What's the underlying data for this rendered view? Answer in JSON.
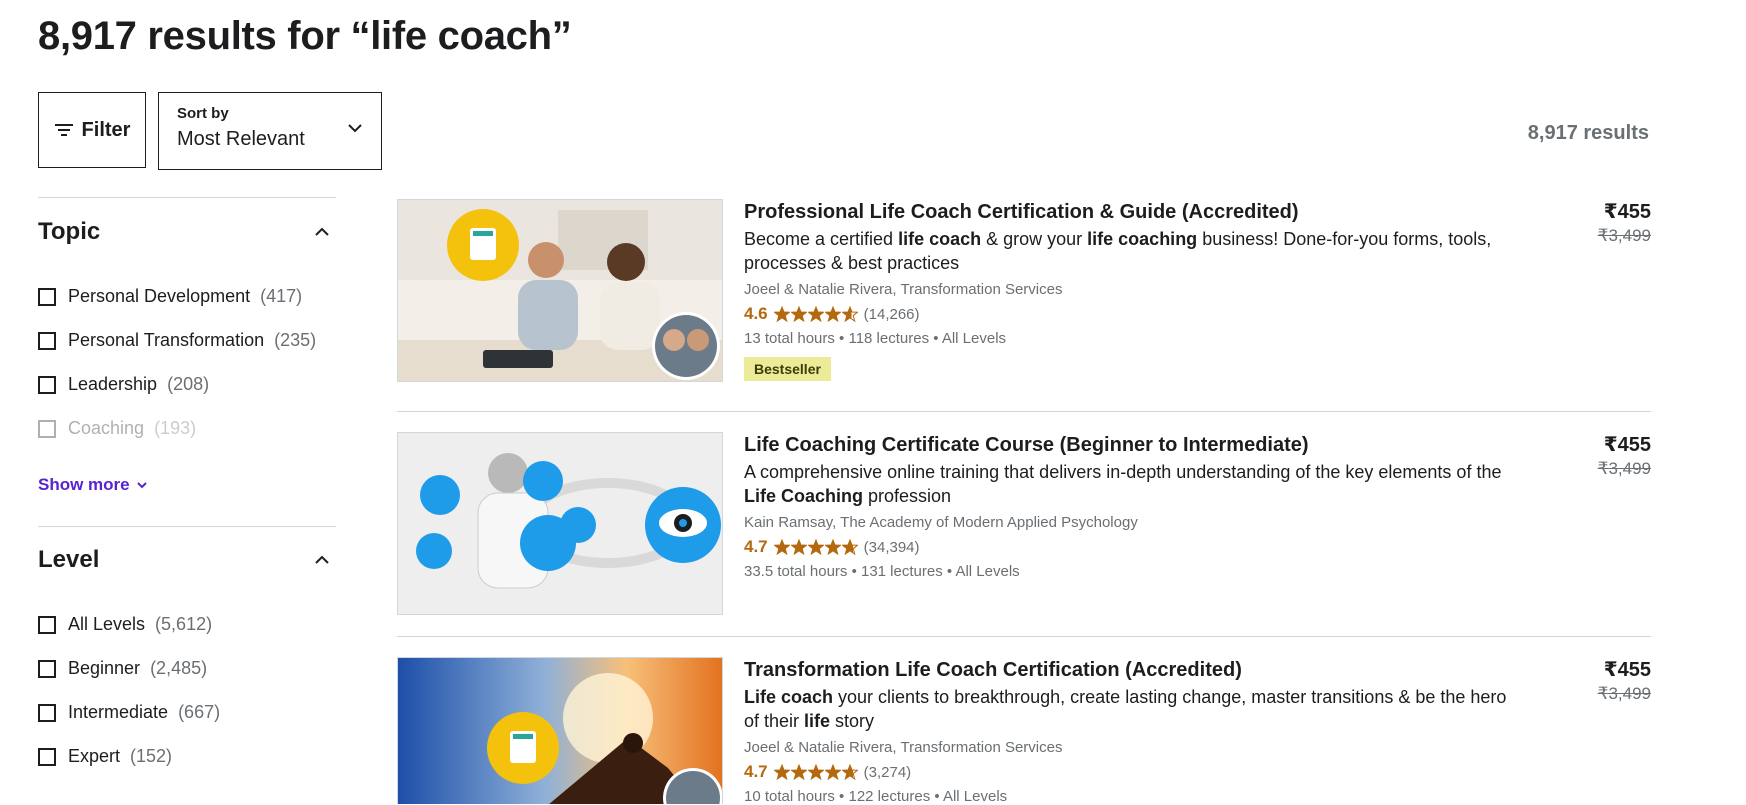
{
  "header": {
    "title": "8,917 results for “life coach”",
    "results_count": "8,917 results"
  },
  "toolbar": {
    "filter_label": "Filter",
    "sort_label": "Sort by",
    "sort_value": "Most Relevant"
  },
  "sidebar": {
    "topic": {
      "title": "Topic",
      "items": [
        {
          "label": "Personal Development",
          "count": "(417)"
        },
        {
          "label": "Personal Transformation",
          "count": "(235)"
        },
        {
          "label": "Leadership",
          "count": "(208)"
        },
        {
          "label": "Coaching",
          "count": "(193)"
        }
      ],
      "show_more": "Show more"
    },
    "level": {
      "title": "Level",
      "items": [
        {
          "label": "All Levels",
          "count": "(5,612)"
        },
        {
          "label": "Beginner",
          "count": "(2,485)"
        },
        {
          "label": "Intermediate",
          "count": "(667)"
        },
        {
          "label": "Expert",
          "count": "(152)"
        }
      ]
    }
  },
  "courses": [
    {
      "title": "Professional Life Coach Certification & Guide (Accredited)",
      "desc_parts": [
        "Become a certified ",
        "life coach",
        " & grow your ",
        "life coaching",
        " business! Done-for-you forms, tools, processes & best practices"
      ],
      "instructor": "Joeel & Natalie Rivera, Transformation Services",
      "rating": "4.6",
      "rating_value": 4.6,
      "reviews": "(14,266)",
      "meta": "13 total hours • 118 lectures • All Levels",
      "badge": "Bestseller",
      "price": "₹455",
      "old_price": "₹3,499"
    },
    {
      "title": "Life Coaching Certificate Course (Beginner to Intermediate)",
      "desc_parts": [
        "A comprehensive online training that delivers in-depth understanding of the key elements of the ",
        "Life Coaching",
        " profession"
      ],
      "instructor": "Kain Ramsay, The Academy of Modern Applied Psychology",
      "rating": "4.7",
      "rating_value": 4.7,
      "reviews": "(34,394)",
      "meta": "33.5 total hours • 131 lectures • All Levels",
      "price": "₹455",
      "old_price": "₹3,499"
    },
    {
      "title": "Transformation Life Coach Certification (Accredited)",
      "desc_parts": [
        "Life coach",
        " your clients to breakthrough, create lasting change, master transitions & be the hero of their ",
        "life",
        " story"
      ],
      "instructor": "Joeel & Natalie Rivera, Transformation Services",
      "rating": "4.7",
      "rating_value": 4.7,
      "reviews": "(3,274)",
      "meta": "10 total hours • 122 lectures • All Levels",
      "price": "₹455",
      "old_price": "₹3,499"
    }
  ],
  "colors": {
    "accent": "#5624d0",
    "rating": "#b4690e",
    "badge_bg": "#eceb98",
    "text": "#1c1d1f",
    "muted": "#6a6f73"
  }
}
